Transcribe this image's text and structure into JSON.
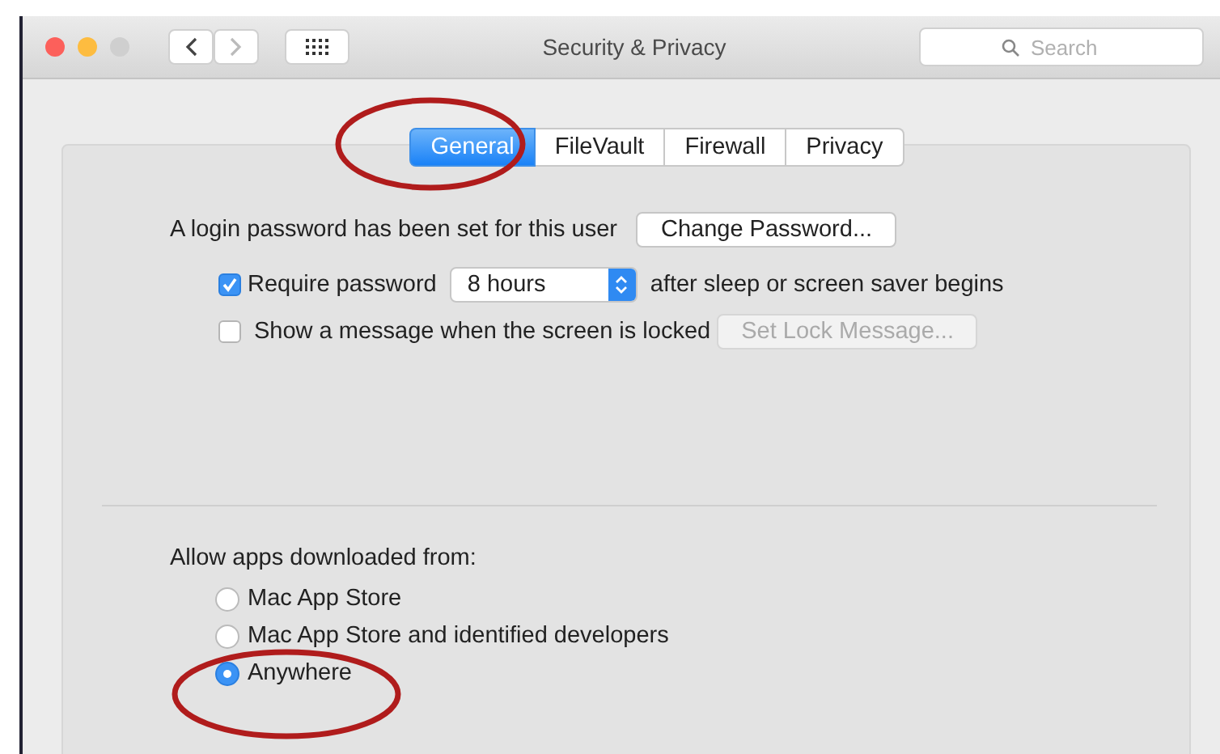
{
  "window": {
    "title": "Security & Privacy"
  },
  "toolbar": {
    "search": {
      "placeholder": "Search"
    }
  },
  "tabs": [
    {
      "label": "General",
      "selected": true
    },
    {
      "label": "FileVault",
      "selected": false
    },
    {
      "label": "Firewall",
      "selected": false
    },
    {
      "label": "Privacy",
      "selected": false
    }
  ],
  "general": {
    "login_text": "A login password has been set for this user",
    "change_password_button": "Change Password...",
    "require_password": {
      "label": "Require password",
      "checked": true,
      "delay": "8 hours",
      "suffix": "after sleep or screen saver begins"
    },
    "lock_message": {
      "label": "Show a message when the screen is locked",
      "checked": false,
      "button": "Set Lock Message...",
      "button_disabled": true
    }
  },
  "downloads": {
    "label": "Allow apps downloaded from:",
    "options": [
      {
        "label": "Mac App Store",
        "selected": false
      },
      {
        "label": "Mac App Store and identified developers",
        "selected": false
      },
      {
        "label": "Anywhere",
        "selected": true
      }
    ]
  }
}
